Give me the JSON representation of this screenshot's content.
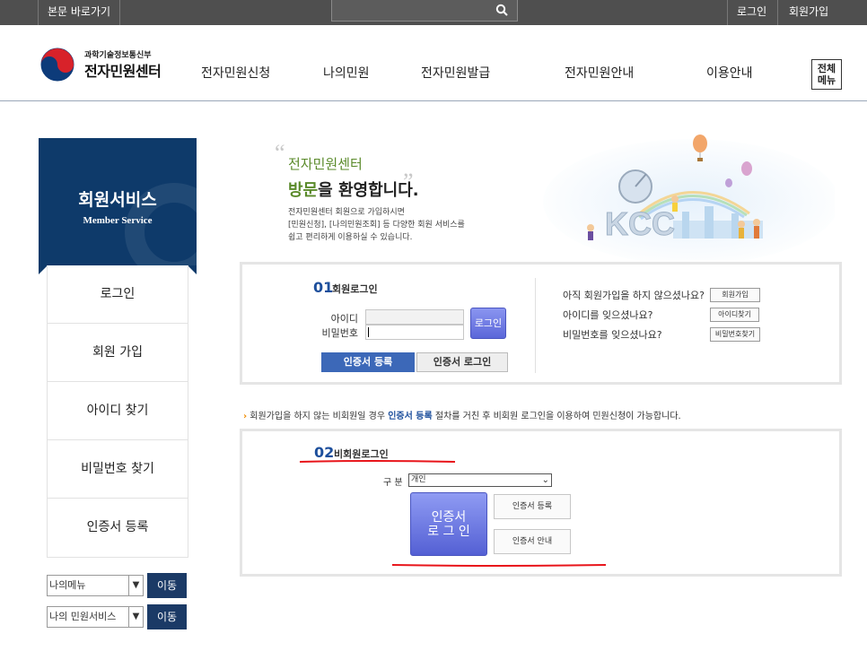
{
  "topbar": {
    "skip_link": "본문 바로가기",
    "search_placeholder": "",
    "login": "로그인",
    "join": "회원가입"
  },
  "header": {
    "logo_sub": "과학기술정보통신부",
    "logo_main": "전자민원센터",
    "nav": [
      "전자민원신청",
      "나의민원",
      "전자민원발급",
      "전자민원안내",
      "이용안내"
    ],
    "menu_all": [
      "전체",
      "메뉴"
    ]
  },
  "sidebar": {
    "title": "회원서비스",
    "subtitle": "Member Service",
    "items": [
      "로그인",
      "회원 가입",
      "아이디 찾기",
      "비밀번호 찾기",
      "인증서 등록"
    ],
    "select1": "나의메뉴",
    "select2": "나의 민원서비스",
    "go_label": "이동"
  },
  "welcome": {
    "line1": "전자민원센터",
    "line2_highlight": "방문",
    "line2_rest": "을 환영합니다.",
    "desc": [
      "전자민원센터 회원으로 가입하시면",
      "[민원신청], [나의민원조회] 등 다양한 회원 서비스를",
      "쉽고 편리하게 이용하실 수 있습니다."
    ],
    "banner_text": "KCC"
  },
  "member_login": {
    "num": "01",
    "title": "회원로그인",
    "id_label": "아이디",
    "pw_label": "비밀번호",
    "id_value": "",
    "pw_value": "",
    "login_button": "로그인",
    "cert_register_button": "인증서 등록",
    "cert_login_button": "인증서 로그인",
    "help": [
      {
        "question": "아직 회원가입을 하지 않으셨나요?",
        "button": "회원가입"
      },
      {
        "question": "아이디를 잊으셨나요?",
        "button": "아이디찾기"
      },
      {
        "question": "비밀번호를 잊으셨나요?",
        "button": "비밀번호찾기"
      }
    ]
  },
  "notice": {
    "bullet": "›",
    "before": " 회원가입을 하지 않는 비회원일 경우 ",
    "highlight": "인증서 등록",
    "after": " 절차를 거친 후 비회원 로그인을 이용하여 민원신청이 가능합니다."
  },
  "nonmember_login": {
    "num": "02",
    "title": "비회원로그인",
    "division_label": "구 분",
    "division_value": "개인",
    "cert_login_button": [
      "인증서",
      "로 그 인"
    ],
    "cert_register_button": "인증서 등록",
    "cert_guide_button": "인증서 안내"
  },
  "colors": {
    "sidebar_bg": "#0e3a6a",
    "accent_blue": "#1d4f9c",
    "green": "#5a8a2a",
    "annotation_red": "#e8141a"
  }
}
